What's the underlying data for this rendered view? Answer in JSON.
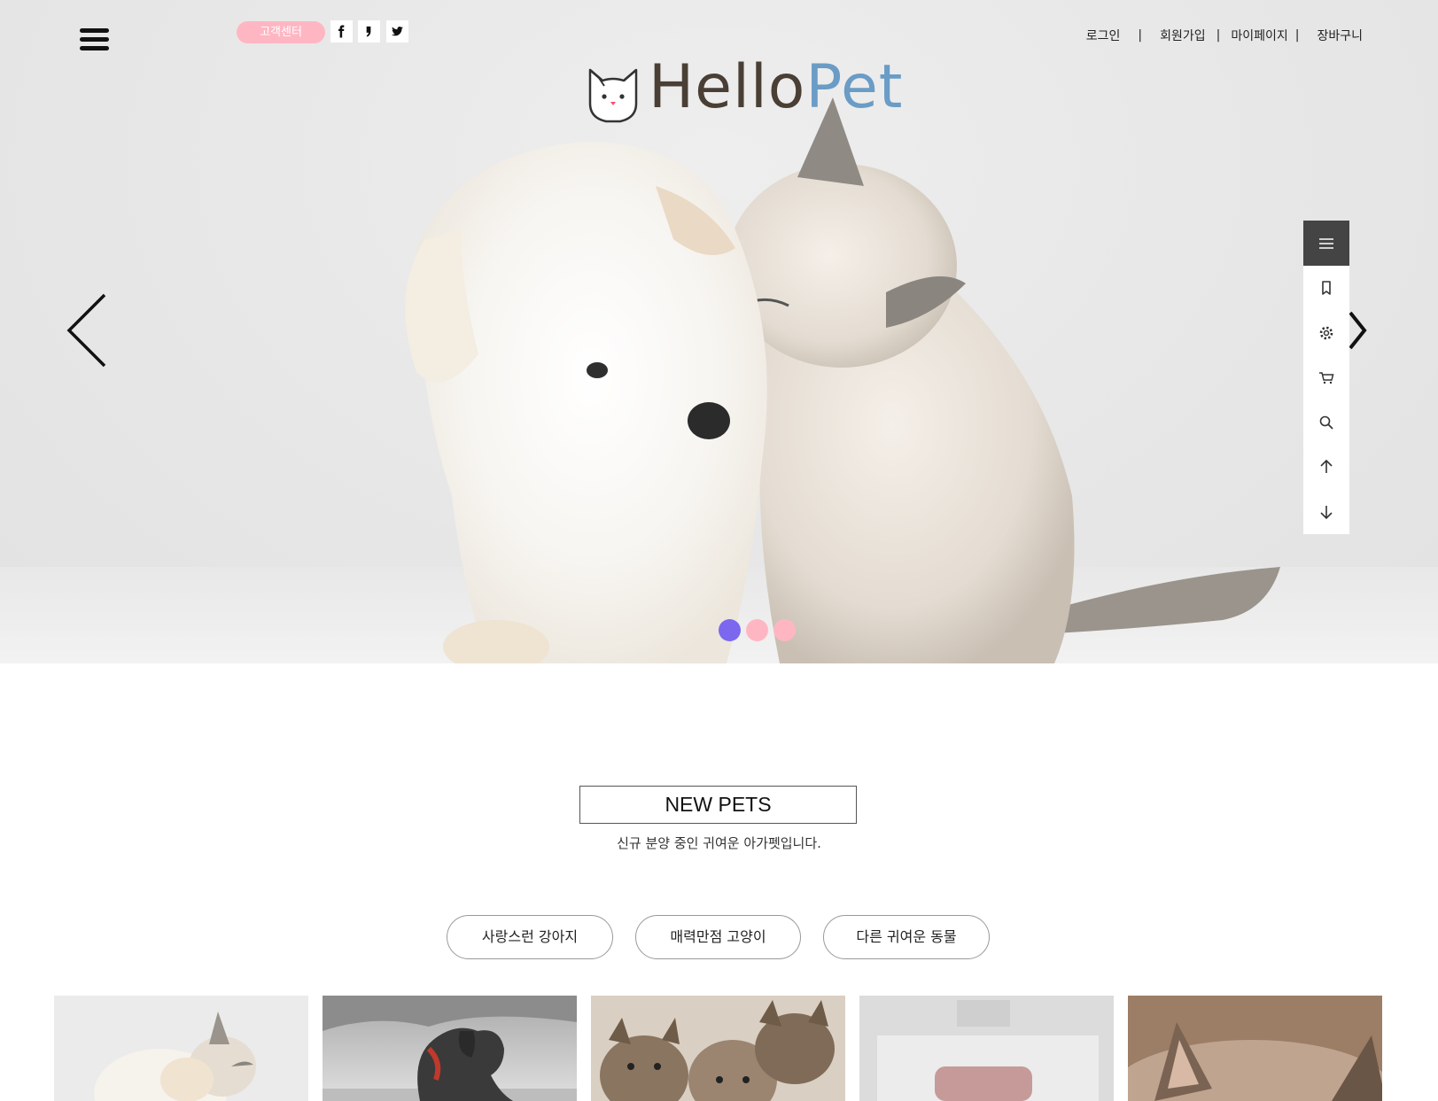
{
  "header": {
    "menu_icon": "hamburger-icon",
    "customer_center": "고객센터",
    "social": [
      "facebook-icon",
      "blog-icon",
      "twitter-icon"
    ],
    "logo": {
      "hello": "Hello",
      "pet": "Pet"
    },
    "top_links": [
      "로그인",
      "회원가입",
      "마이페이지",
      "장바구니"
    ]
  },
  "hero": {
    "prev_icon": "chevron-left-icon",
    "next_icon": "chevron-right-icon",
    "slides": 3,
    "active_slide": 1,
    "dot_colors": [
      "#7b68ee",
      "#ffb6c3",
      "#ffb6c3"
    ]
  },
  "quick_menu": [
    "menu-icon",
    "bookmark-icon",
    "settings-icon",
    "cart-icon",
    "search-icon",
    "arrow-up-icon",
    "arrow-down-icon"
  ],
  "new_pets": {
    "title": "NEW PETS",
    "subtitle": "신규 분양 중인 귀여운 아가펫입니다.",
    "categories": [
      "사랑스런 강아지",
      "매력만점 고양이",
      "다른 귀여운 동물"
    ]
  },
  "colors": {
    "accent_pink": "#ffb6c3",
    "accent_purple": "#7b68ee",
    "logo_brown": "#4a3f35",
    "logo_blue": "#6a9cc6"
  }
}
